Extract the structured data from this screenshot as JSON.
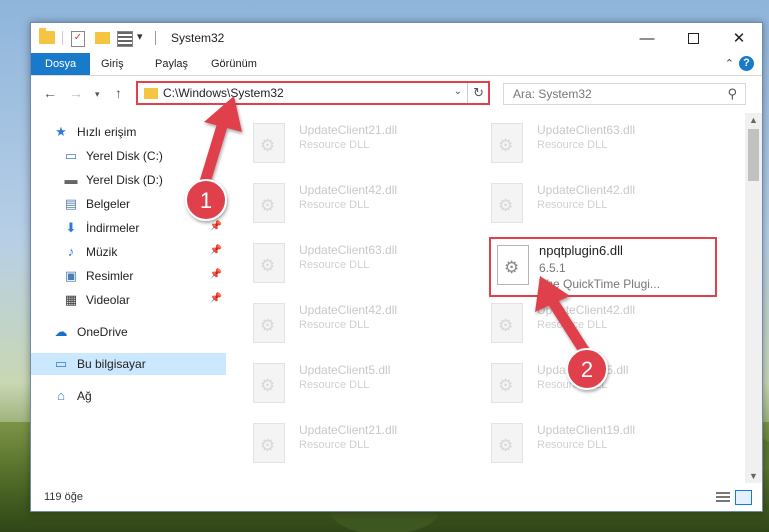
{
  "window": {
    "title": "System32",
    "minimize": "—",
    "close": "✕"
  },
  "quick_access": {
    "check": "✓",
    "dropdown": "▾"
  },
  "ribbon": {
    "tabs": [
      {
        "label": "Dosya"
      },
      {
        "label": "Giriş"
      },
      {
        "label": "Paylaş"
      },
      {
        "label": "Görünüm"
      }
    ],
    "collapse_icon": "⌃",
    "help": "?"
  },
  "nav": {
    "back": "←",
    "forward": "→",
    "recent": "▾",
    "up": "↑",
    "address": "C:\\Windows\\System32",
    "address_dropdown": "⌄",
    "refresh": "↻",
    "search_placeholder": "Ara: System32",
    "search_icon": "⚲"
  },
  "sidebar": {
    "items": [
      {
        "label": "Hızlı erişim",
        "icon": "★"
      },
      {
        "label": "Yerel Disk (C:)",
        "icon": "▭"
      },
      {
        "label": "Yerel Disk (D:)",
        "icon": "▬"
      },
      {
        "label": "Belgeler",
        "icon": "▤"
      },
      {
        "label": "İndirmeler",
        "icon": "⬇",
        "pin": "📌"
      },
      {
        "label": "Müzik",
        "icon": "♪",
        "pin": "📌"
      },
      {
        "label": "Resimler",
        "icon": "▣",
        "pin": "📌"
      },
      {
        "label": "Videolar",
        "icon": "▦",
        "pin": "📌"
      },
      {
        "label": "OneDrive",
        "icon": "☁"
      },
      {
        "label": "Bu bilgisayar",
        "icon": "▭"
      },
      {
        "label": "Ağ",
        "icon": "⌂"
      }
    ]
  },
  "files": [
    {
      "name": "UpdateClient21.dll",
      "desc": "Resource DLL"
    },
    {
      "name": "UpdateClient63.dll",
      "desc": "Resource DLL"
    },
    {
      "name": "UpdateClient42.dll",
      "desc": "Resource DLL"
    },
    {
      "name": "UpdateClient42.dll",
      "desc": "Resource DLL"
    },
    {
      "name": "UpdateClient63.dll",
      "desc": "Resource DLL"
    },
    {
      "name": "npqtplugin6.dll",
      "version": "6.5.1",
      "desc": "The QuickTime Plugi..."
    },
    {
      "name": "UpdateClient42.dll",
      "desc": "Resource DLL"
    },
    {
      "name": "UpdateClient42.dll",
      "desc": "Resource DLL"
    },
    {
      "name": "UpdateClient5.dll",
      "desc": "Resource DLL"
    },
    {
      "name": "UpdateClient5.dll",
      "desc": "Resource DLL"
    },
    {
      "name": "UpdateClient21.dll",
      "desc": "Resource DLL"
    },
    {
      "name": "UpdateClient19.dll",
      "desc": "Resource DLL"
    }
  ],
  "scrollbar": {
    "up": "▲",
    "down": "▼"
  },
  "status": {
    "item_count": "119 öğe"
  },
  "annotations": [
    {
      "number": "1"
    },
    {
      "number": "2"
    }
  ],
  "colors": {
    "accent": "#1979ca",
    "highlight_box": "#e0414b",
    "selected_bg": "#cce8ff"
  }
}
